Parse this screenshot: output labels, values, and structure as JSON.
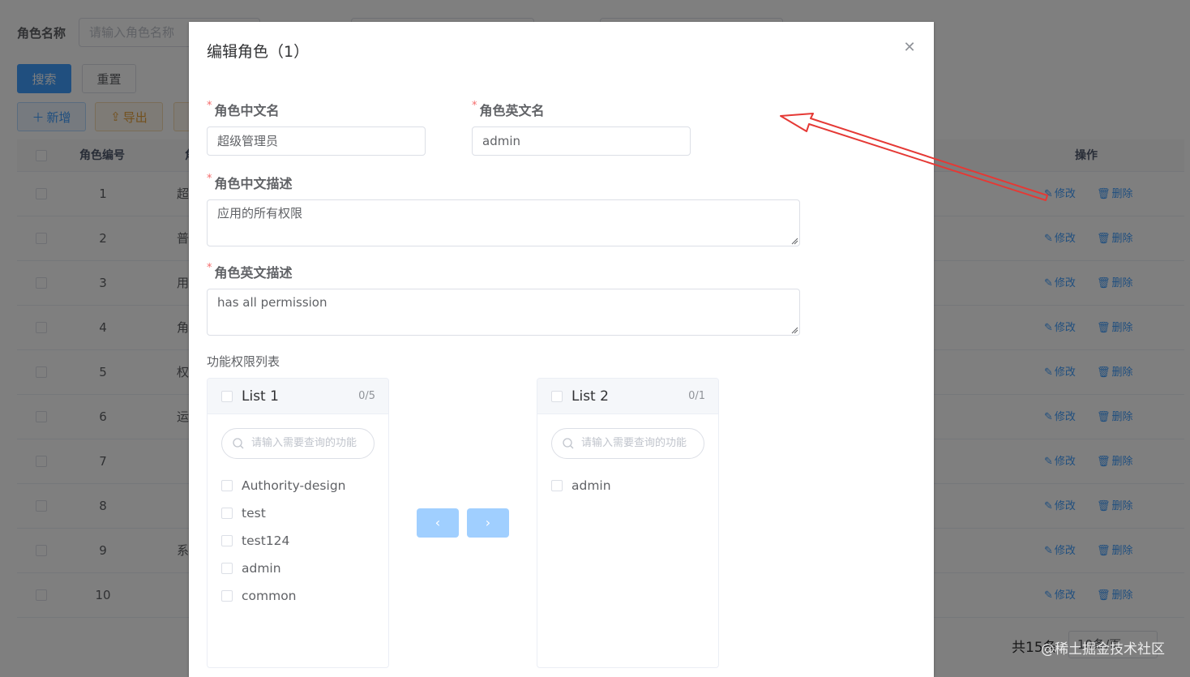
{
  "background": {
    "search": {
      "label": "角色名称",
      "placeholder": "请输入角色名称"
    },
    "buttons": {
      "search": "搜索",
      "reset": "重置",
      "add": "新增",
      "export": "导出"
    },
    "table": {
      "headers": {
        "id": "角色编号",
        "name_partial": "角",
        "ops": "操作"
      },
      "rows": [
        {
          "id": "1",
          "name_partial": "超"
        },
        {
          "id": "2",
          "name_partial": "普"
        },
        {
          "id": "3",
          "name_partial": "用"
        },
        {
          "id": "4",
          "name_partial": "角"
        },
        {
          "id": "5",
          "name_partial": "权"
        },
        {
          "id": "6",
          "name_partial": "运"
        },
        {
          "id": "7",
          "name_partial": ""
        },
        {
          "id": "8",
          "name_partial": ""
        },
        {
          "id": "9",
          "name_partial": "系"
        },
        {
          "id": "10",
          "name_partial": ""
        }
      ],
      "op_edit": "修改",
      "op_delete": "删除"
    },
    "pager": {
      "total": "共15条",
      "size": "10条/页"
    }
  },
  "dialog": {
    "title": "编辑角色（1）",
    "fields": {
      "name_cn_label": "角色中文名",
      "name_cn_value": "超级管理员",
      "name_en_label": "角色英文名",
      "name_en_value": "admin",
      "desc_cn_label": "角色中文描述",
      "desc_cn_value": "应用的所有权限",
      "desc_en_label": "角色英文描述",
      "desc_en_value": "has all permission",
      "perm_label": "功能权限列表"
    },
    "transfer": {
      "left": {
        "title": "List 1",
        "count": "0/5",
        "filter_placeholder": "请输入需要查询的功能",
        "items": [
          "Authority-design",
          "test",
          "test124",
          "admin",
          "common"
        ]
      },
      "right": {
        "title": "List 2",
        "count": "0/1",
        "filter_placeholder": "请输入需要查询的功能",
        "items": [
          "admin"
        ]
      }
    }
  },
  "watermark": "@稀土掘金技术社区",
  "colors": {
    "primary": "#409eff",
    "arrow": "#e53935",
    "danger": "#f56c6c"
  }
}
